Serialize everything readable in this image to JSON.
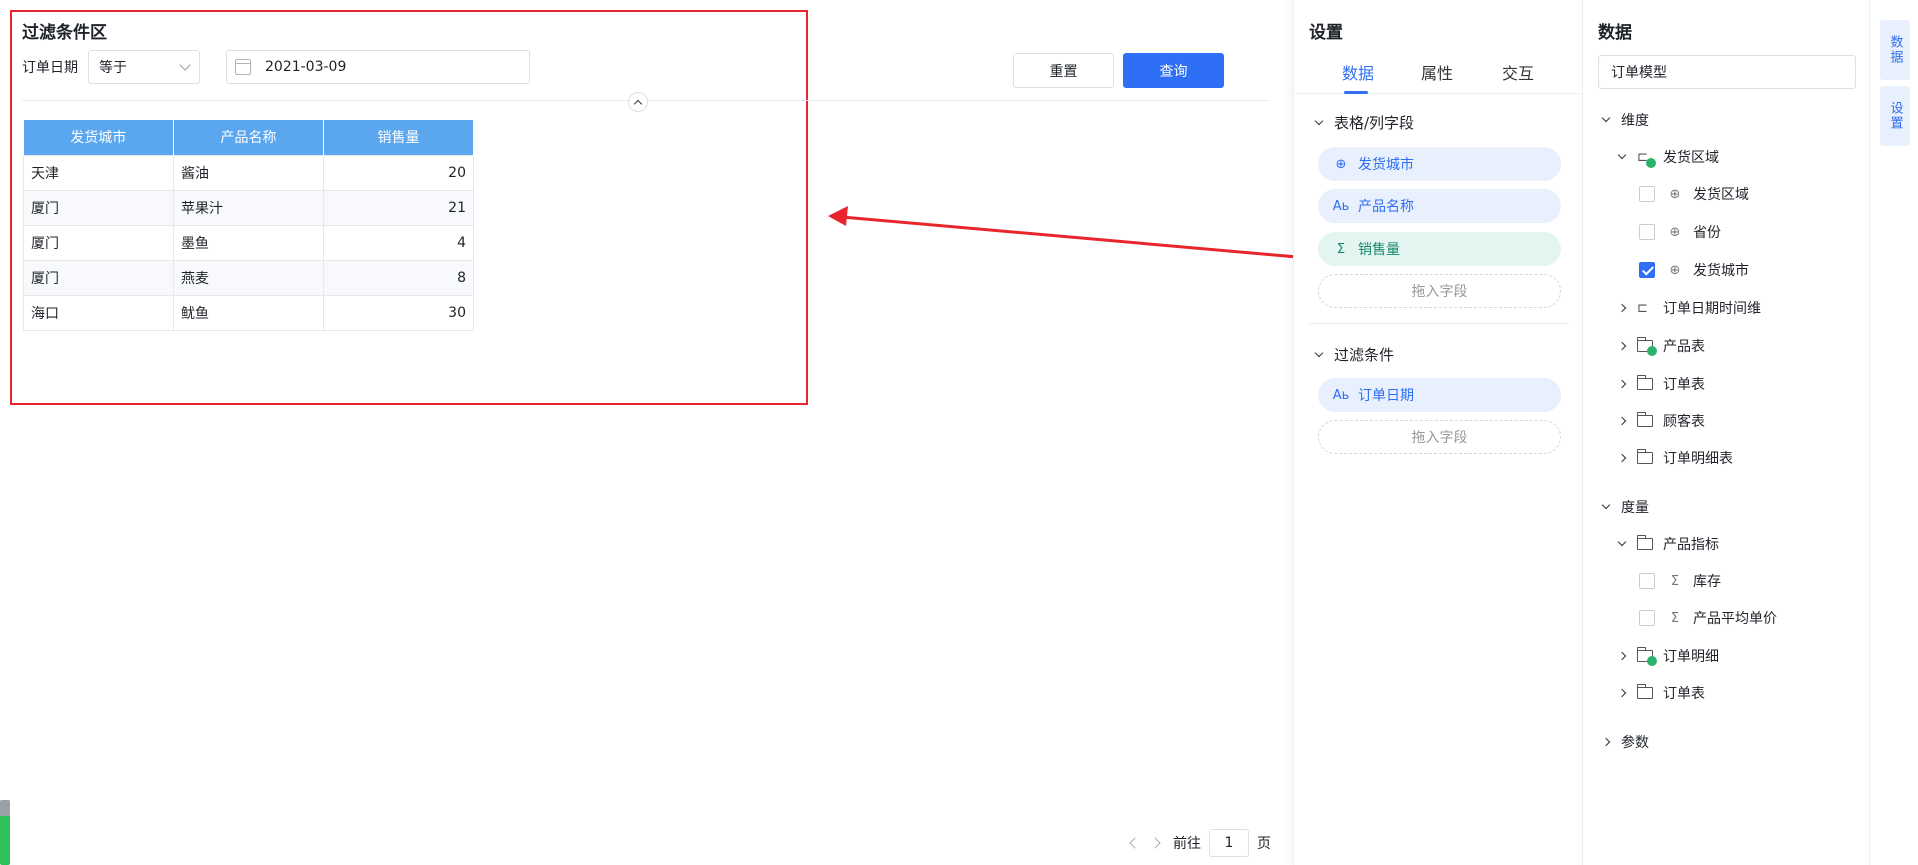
{
  "canvas": {
    "filter_area_title": "过滤条件区",
    "filter": {
      "label": "订单日期",
      "operator": "等于",
      "date_value": "2021-03-09"
    },
    "buttons": {
      "reset": "重置",
      "query": "查询"
    },
    "table": {
      "headers": [
        "发货城市",
        "产品名称",
        "销售量"
      ],
      "rows": [
        [
          "天津",
          "酱油",
          "20"
        ],
        [
          "厦门",
          "苹果汁",
          "21"
        ],
        [
          "厦门",
          "墨鱼",
          "4"
        ],
        [
          "厦门",
          "燕麦",
          "8"
        ],
        [
          "海口",
          "鱿鱼",
          "30"
        ]
      ]
    },
    "pager": {
      "goto_label": "前往",
      "page": "1",
      "page_suffix": "页"
    },
    "highlight_color": "#e8242c"
  },
  "settings": {
    "title": "设置",
    "tabs": [
      "数据",
      "属性",
      "交互"
    ],
    "active_tab": "数据",
    "sections": {
      "columns": {
        "title": "表格/列字段",
        "fields": [
          {
            "icon": "globe-icon",
            "label": "发货城市"
          },
          {
            "icon": "text-field-icon",
            "label": "产品名称"
          },
          {
            "icon": "sigma-icon",
            "label": "销售量"
          }
        ],
        "drop_hint": "拖入字段"
      },
      "filters": {
        "title": "过滤条件",
        "fields": [
          {
            "icon": "text-field-icon",
            "label": "订单日期"
          }
        ],
        "drop_hint": "拖入字段"
      }
    }
  },
  "data_panel": {
    "title": "数据",
    "model": "订单模型",
    "dimension_title": "维度",
    "region_hierarchy": "发货区域",
    "region_children": [
      {
        "label": "发货区域",
        "checked": false
      },
      {
        "label": "省份",
        "checked": false
      },
      {
        "label": "发货城市",
        "checked": true
      }
    ],
    "date_hierarchy": "订单日期时间维",
    "tables": [
      "产品表",
      "订单表",
      "顾客表",
      "订单明细表"
    ],
    "measure_title": "度量",
    "measure_folder": "产品指标",
    "measure_children": [
      "库存",
      "产品平均单价"
    ],
    "measure_folders": [
      "订单明细",
      "订单表"
    ],
    "param_title": "参数"
  },
  "rail": {
    "tabs": [
      "数据",
      "设置"
    ]
  }
}
